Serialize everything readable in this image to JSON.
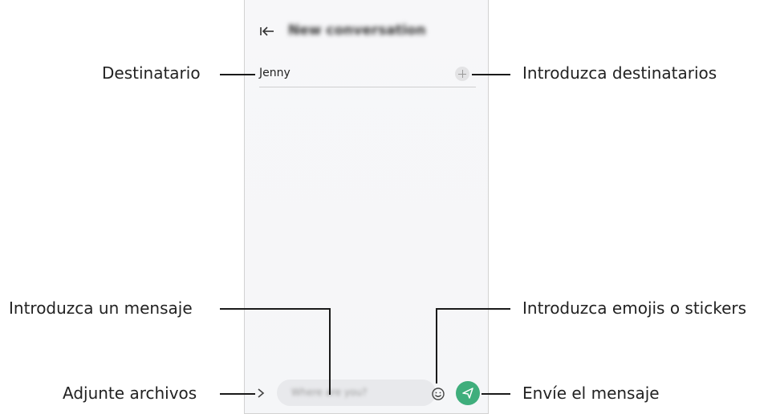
{
  "screen": {
    "header": {
      "title": "New conversation",
      "back_icon": "back-to-start-icon"
    },
    "recipient": {
      "value": "Jenny",
      "add_icon": "plus-circle-icon"
    },
    "composer": {
      "placeholder": "Where are you?",
      "expand_icon": "chevron-right-icon",
      "emoji_icon": "smiley-icon",
      "send_icon": "send-arrow-icon",
      "send_color": "#3fae7c"
    }
  },
  "callouts": {
    "destinatario": "Destinatario",
    "introduzca_destinatarios": "Introduzca destinatarios",
    "introduzca_mensaje": "Introduzca un mensaje",
    "introduzca_emojis": "Introduzca emojis o stickers",
    "adjunte_archivos": "Adjunte archivos",
    "envie_mensaje": "Envíe el mensaje"
  }
}
